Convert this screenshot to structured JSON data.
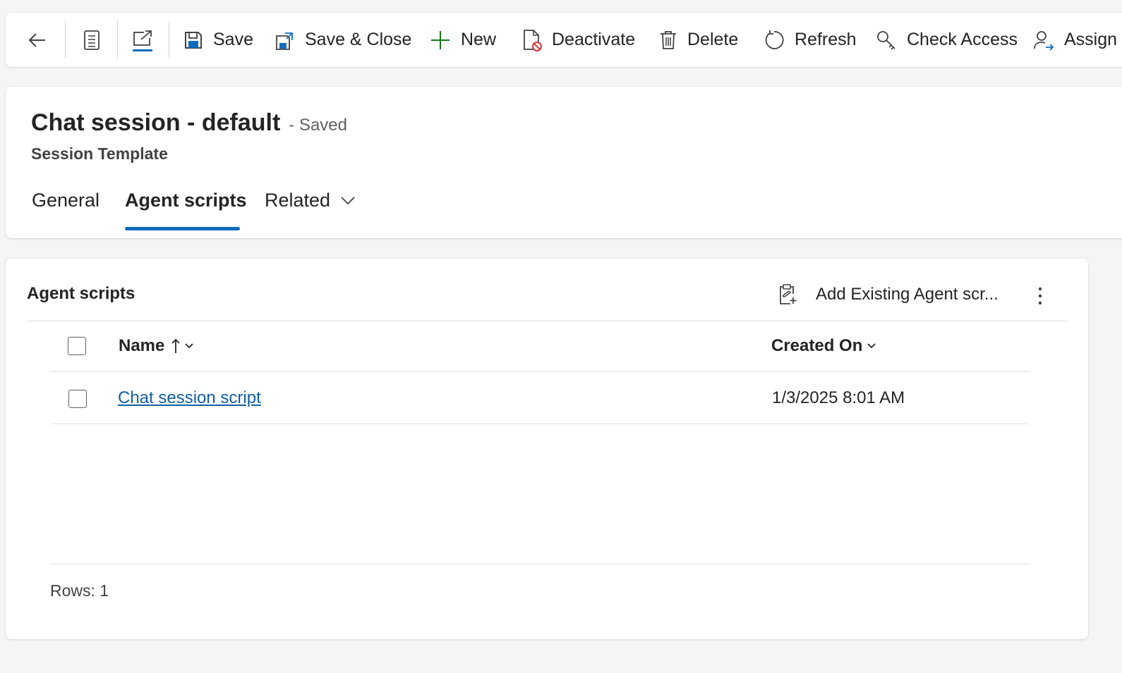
{
  "toolbar": {
    "save_label": "Save",
    "save_close_label": "Save & Close",
    "new_label": "New",
    "deactivate_label": "Deactivate",
    "delete_label": "Delete",
    "refresh_label": "Refresh",
    "check_access_label": "Check Access",
    "assign_label": "Assign"
  },
  "header": {
    "title": "Chat session - default",
    "save_status": "- Saved",
    "entity_type": "Session Template"
  },
  "tabs": [
    {
      "label": "General",
      "active": false
    },
    {
      "label": "Agent scripts",
      "active": true
    },
    {
      "label": "Related",
      "active": false
    }
  ],
  "subgrid": {
    "title": "Agent scripts",
    "add_existing_label": "Add Existing Agent scr...",
    "columns": [
      {
        "label": "Name",
        "sorted": "ascending"
      },
      {
        "label": "Created On"
      }
    ],
    "rows": [
      {
        "name": "Chat session script",
        "created_on": "1/3/2025 8:01 AM"
      }
    ],
    "rows_label": "Rows: 1"
  },
  "colors": {
    "accent": "#0f6cbd",
    "link": "#115ea3",
    "new_icon": "#107c10",
    "deactivate_badge": "#d13438"
  }
}
